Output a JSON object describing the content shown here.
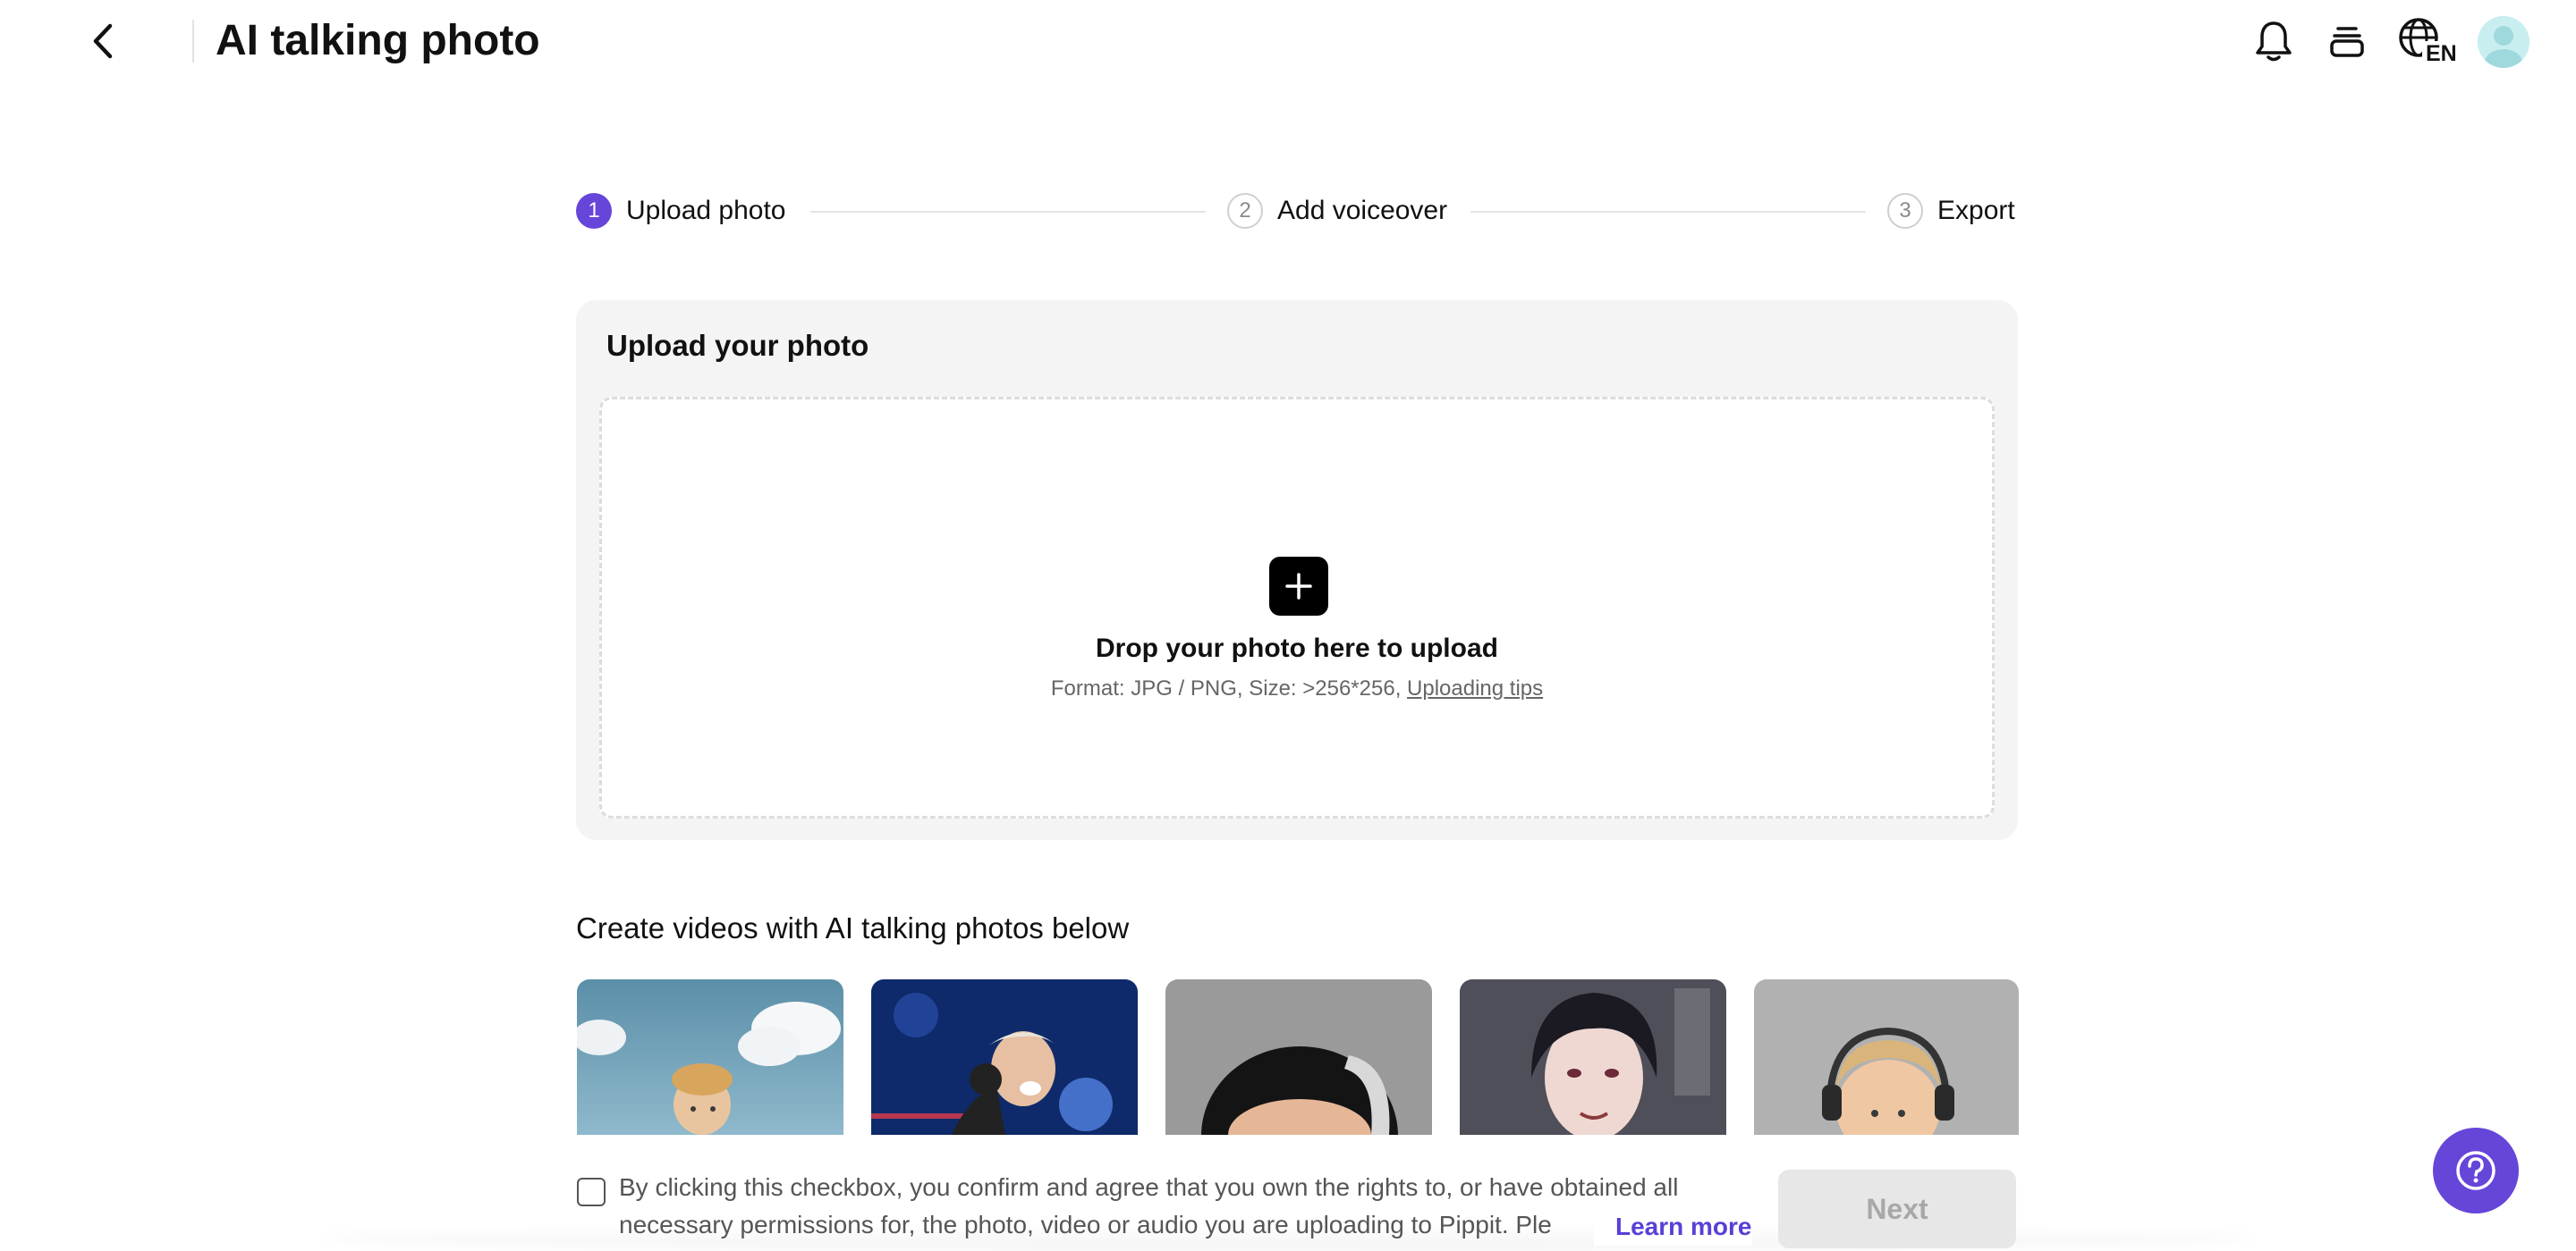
{
  "header": {
    "title": "AI talking photo",
    "language_code": "EN",
    "icons": [
      "back-arrow-icon",
      "bell-icon",
      "credits-icon",
      "globe-icon",
      "avatar"
    ]
  },
  "stepper": {
    "steps": [
      {
        "number": "1",
        "label": "Upload photo",
        "state": "active"
      },
      {
        "number": "2",
        "label": "Add voiceover",
        "state": "inactive"
      },
      {
        "number": "3",
        "label": "Export",
        "state": "inactive"
      }
    ]
  },
  "upload": {
    "title": "Upload your photo",
    "drop_text": "Drop your photo here to upload",
    "format_text": "Format: JPG / PNG, Size: >256*256, ",
    "tips_link": "Uploading tips"
  },
  "gallery": {
    "title": "Create videos with AI talking photos below"
  },
  "footer": {
    "consent_text": "By clicking this checkbox, you confirm and agree that you own the rights to, or have obtained all necessary permissions for, the photo, video or audio you are uploading to Pippit. Ple",
    "learn_more": "Learn more",
    "next_label": "Next",
    "checked": false
  },
  "colors": {
    "accent": "#6645d9",
    "link": "#5a3fd6",
    "card_bg": "#f4f4f4",
    "disabled_button": "#e7e7e7"
  }
}
